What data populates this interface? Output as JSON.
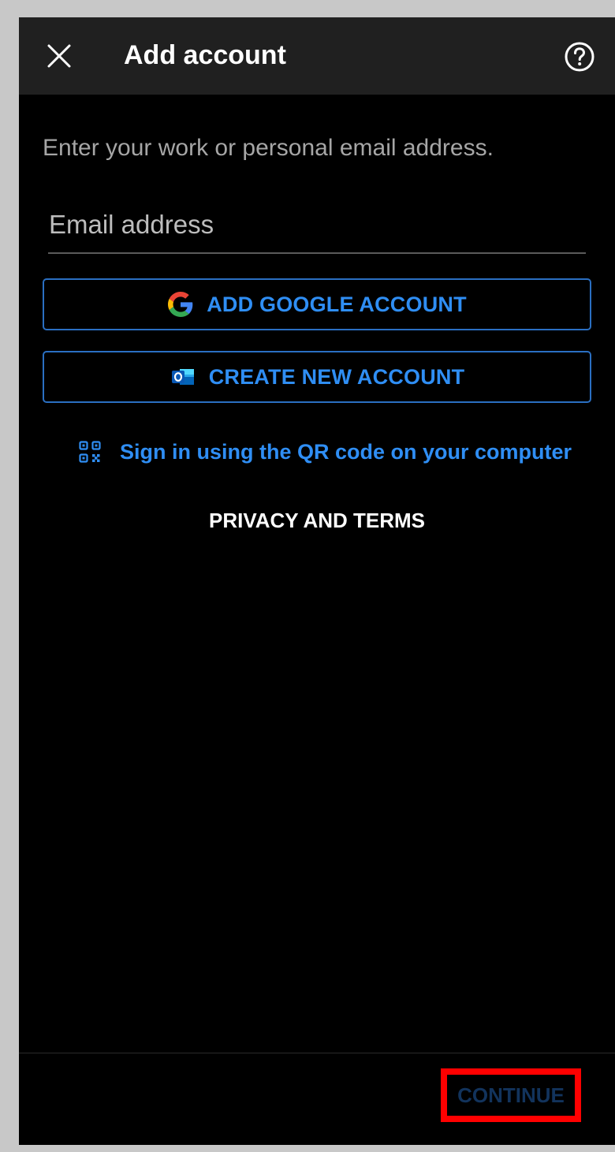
{
  "header": {
    "title": "Add account",
    "close_icon": "close-icon",
    "help_icon": "help-icon"
  },
  "form": {
    "instruction": "Enter your work or personal email address.",
    "email_placeholder": "Email address",
    "email_value": ""
  },
  "actions": {
    "google_label": "ADD GOOGLE ACCOUNT",
    "google_icon": "google-icon",
    "create_label": "CREATE NEW ACCOUNT",
    "create_icon": "outlook-icon",
    "qr_label": "Sign in using the QR code on your computer",
    "qr_icon": "qr-code-icon",
    "privacy_label": "PRIVACY AND TERMS"
  },
  "footer": {
    "continue_label": "CONTINUE",
    "continue_state": "disabled",
    "highlight_color": "#ff0000"
  },
  "colors": {
    "accent": "#2f8ef4",
    "header_bg": "#202020",
    "page_bg": "#000000"
  }
}
